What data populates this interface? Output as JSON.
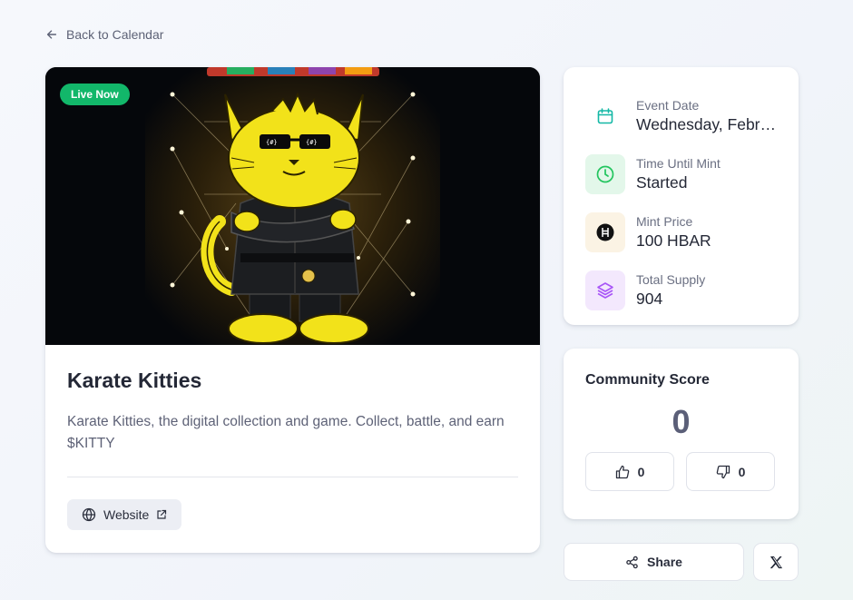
{
  "nav": {
    "back_label": "Back to Calendar"
  },
  "project": {
    "status_badge": "Live Now",
    "title": "Karate Kitties",
    "description": "Karate Kitties, the digital collection and game. Collect, battle, and earn $KITTY",
    "website_label": "Website"
  },
  "info": [
    {
      "label": "Event Date",
      "value": "Wednesday, February",
      "icon": "calendar-icon",
      "color": "#14b8a6",
      "bg": "#ffffff"
    },
    {
      "label": "Time Until Mint",
      "value": "Started",
      "icon": "clock-icon",
      "color": "#22c55e",
      "bg": "#e3f7ea"
    },
    {
      "label": "Mint Price",
      "value": "100 HBAR",
      "icon": "hbar-icon",
      "color": "#111111",
      "bg": "#fbf3e4"
    },
    {
      "label": "Total Supply",
      "value": "904",
      "icon": "layers-icon",
      "color": "#a855f7",
      "bg": "#f3e8fd"
    }
  ],
  "community": {
    "title": "Community Score",
    "score": "0",
    "upvotes": "0",
    "downvotes": "0"
  },
  "actions": {
    "share_label": "Share",
    "x_icon": "x-logo-icon"
  },
  "colors": {
    "accent_green": "#12b76a",
    "text_dark": "#242836",
    "text_muted": "#5e6277"
  }
}
